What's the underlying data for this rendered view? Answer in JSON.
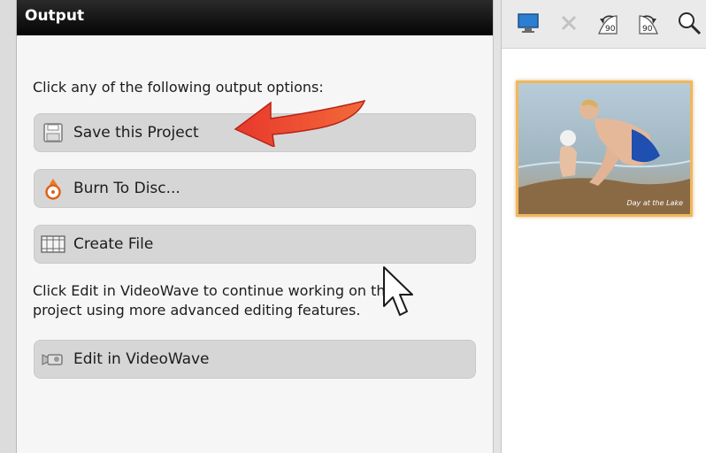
{
  "panel": {
    "title": "Output",
    "instructions": "Click any of the following output options:",
    "options": [
      {
        "label": "Save this Project",
        "icon": "floppy-disk-icon"
      },
      {
        "label": "Burn To Disc...",
        "icon": "disc-burn-icon"
      },
      {
        "label": "Create File",
        "icon": "film-strip-icon"
      }
    ],
    "note_line1": "Click Edit in VideoWave to continue working on this",
    "note_line2": "project using more advanced editing features.",
    "edit_button": {
      "label": "Edit in VideoWave",
      "icon": "video-camera-icon"
    }
  },
  "toolbar": {
    "icons": [
      "monitor-icon",
      "delete-icon",
      "rotate-left-90-icon",
      "rotate-right-90-icon",
      "zoom-icon"
    ],
    "rotate_left_label": "90",
    "rotate_right_label": "90"
  },
  "preview": {
    "caption": "Day at the Lake"
  },
  "colors": {
    "header_bg": "#050505",
    "button_bg": "#d6d6d6",
    "thumbnail_border": "#f2b75a",
    "annotation_arrow": "#e8382c"
  }
}
